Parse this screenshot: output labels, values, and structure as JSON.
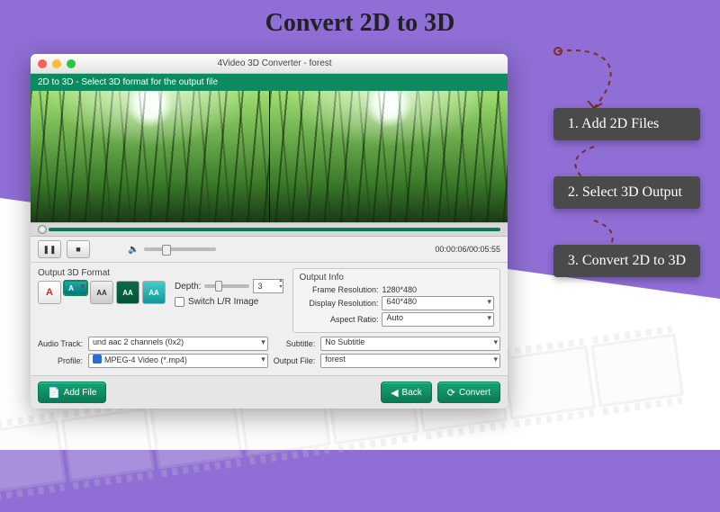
{
  "page": {
    "heading": "Convert 2D to 3D"
  },
  "steps": [
    {
      "label": "1. Add 2D Files"
    },
    {
      "label": "2. Select 3D Output"
    },
    {
      "label": "3. Convert 2D to 3D"
    }
  ],
  "window": {
    "title": "4Video 3D Converter - forest",
    "status_bar": "2D to 3D - Select 3D format for the output file",
    "playback": {
      "time_display": "00:00:06/00:05:55",
      "pause_icon": "❚❚",
      "stop_icon": "■",
      "volume_icon": "🔈"
    },
    "format_panel": {
      "title": "Output 3D Format",
      "options": [
        "A",
        "A",
        "AA",
        "AA",
        "AA"
      ],
      "depth_label": "Depth:",
      "depth_value": "3",
      "switch_label": "Switch L/R Image"
    },
    "output_info": {
      "title": "Output Info",
      "frame_res_label": "Frame Resolution:",
      "frame_res_value": "1280*480",
      "display_res_label": "Display Resolution:",
      "display_res_value": "640*480",
      "aspect_label": "Aspect Ratio:",
      "aspect_value": "Auto"
    },
    "bottom": {
      "audio_label": "Audio Track:",
      "audio_value": "und aac 2 channels (0x2)",
      "subtitle_label": "Subtitle:",
      "subtitle_value": "No Subtitle",
      "profile_label": "Profile:",
      "profile_value": "MPEG-4 Video (*.mp4)",
      "output_file_label": "Output File:",
      "output_file_value": "forest"
    },
    "footer": {
      "add_file": "Add File",
      "back": "Back",
      "convert": "Convert"
    }
  }
}
